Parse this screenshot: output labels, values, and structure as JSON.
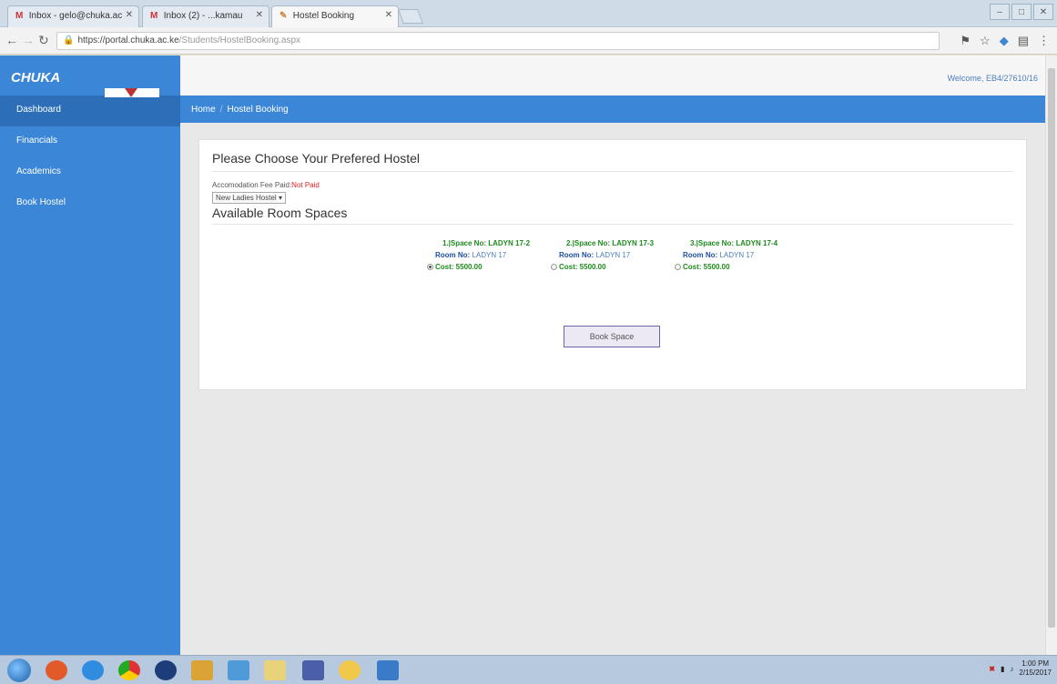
{
  "browser": {
    "tabs": [
      {
        "icon": "M",
        "label": "Inbox - gelo@chuka.ac"
      },
      {
        "icon": "M",
        "label": "Inbox (2) - ...kamau"
      },
      {
        "icon": "✎",
        "label": "Hostel Booking"
      }
    ],
    "url": {
      "host": "https://portal.chuka.ac.ke",
      "path": "/Students/HostelBooking.aspx"
    }
  },
  "sidebar": {
    "brand": "CHUKA",
    "items": [
      {
        "label": "Dashboard"
      },
      {
        "label": "Financials"
      },
      {
        "label": "Academics"
      },
      {
        "label": "Book Hostel"
      }
    ]
  },
  "header": {
    "welcome": "Welcome, EB4/27610/16"
  },
  "breadcrumb": {
    "home": "Home",
    "separator": "/",
    "current": "Hostel Booking"
  },
  "main": {
    "title": "Please Choose Your Prefered Hostel",
    "fee_label": "Accomodation Fee Paid:",
    "fee_status": "Not Paid",
    "hostel_select": "New Ladies Hostel",
    "rooms_title": "Available Room Spaces",
    "rooms": [
      {
        "space": "1.|Space No: LADYN 17-2",
        "room_label": "Room No:",
        "room_value": "LADYN 17",
        "cost": "Cost: 5500.00",
        "selected": true
      },
      {
        "space": "2.|Space No: LADYN 17-3",
        "room_label": "Room No:",
        "room_value": "LADYN 17",
        "cost": "Cost: 5500.00",
        "selected": false
      },
      {
        "space": "3.|Space No: LADYN 17-4",
        "room_label": "Room No:",
        "room_value": "LADYN 17",
        "cost": "Cost: 5500.00",
        "selected": false
      }
    ],
    "book_button": "Book Space"
  },
  "taskbar": {
    "time": "1:00 PM",
    "date": "2/15/2017"
  }
}
